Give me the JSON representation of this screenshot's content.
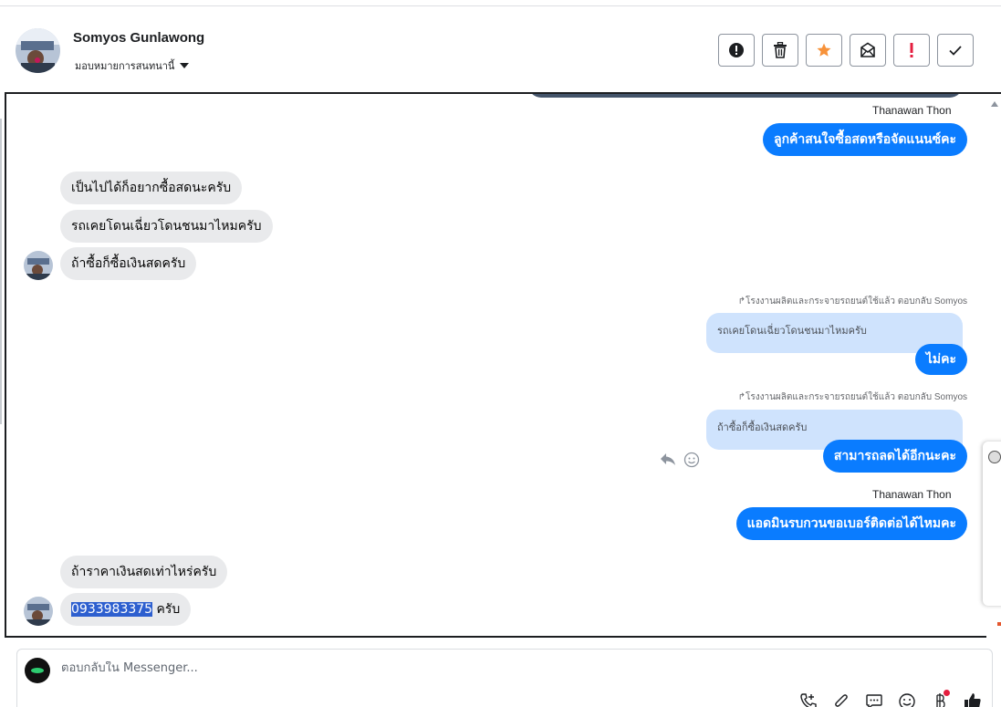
{
  "header": {
    "contact_name": "Somyos Gunlawong",
    "assign_label": "มอบหมายการสนทนานี้",
    "toolbar": [
      {
        "name": "report-button",
        "icon": "alert-circle-icon"
      },
      {
        "name": "delete-button",
        "icon": "trash-icon"
      },
      {
        "name": "star-button",
        "icon": "star-icon",
        "color": "#f7923a"
      },
      {
        "name": "mark-unread-button",
        "icon": "envelope-icon"
      },
      {
        "name": "important-button",
        "icon": "exclamation-icon",
        "color": "#e41e3f"
      },
      {
        "name": "done-button",
        "icon": "check-icon"
      }
    ]
  },
  "messages": {
    "sender_1": "Thanawan Thon",
    "out_1": "ลูกค้าสนใจซื้อสดหรือจัดแนนซ์คะ",
    "in_1": "เป็นไปได้ก็อยากซื้อสดนะครับ",
    "in_2": "รถเคยโดนเฉี่ยวโดนชนมาไหมครับ",
    "in_3": "ถ้าซื้อก็ซื้อเงินสดครับ",
    "reply_meta_1": "โรงงานผลิตและกระจายรถยนต์ใช้แล้ว ตอบกลับ Somyos",
    "quote_1": "รถเคยโดนเฉี่ยวโดนชนมาไหมครับ",
    "out_2": "ไม่คะ",
    "reply_meta_2": "โรงงานผลิตและกระจายรถยนต์ใช้แล้ว ตอบกลับ Somyos",
    "quote_2": "ถ้าซื้อก็ซื้อเงินสดครับ",
    "out_3": "สามารถลดได้อีกนะคะ",
    "sender_2": "Thanawan Thon",
    "out_4": "แอดมินรบกวนขอเบอร์ติดต่อได้ไหมคะ",
    "in_4": "ถ้าราคาเงินสดเท่าไหร่ครับ",
    "in_5_phone": "0933983375",
    "in_5_suffix": "ครับ"
  },
  "composer": {
    "placeholder": "ตอบกลับใน Messenger..."
  },
  "colors": {
    "outgoing_bubble": "#0a7cff",
    "incoming_bubble": "#e9eaec",
    "quote_bubble": "#cfe3fd"
  }
}
